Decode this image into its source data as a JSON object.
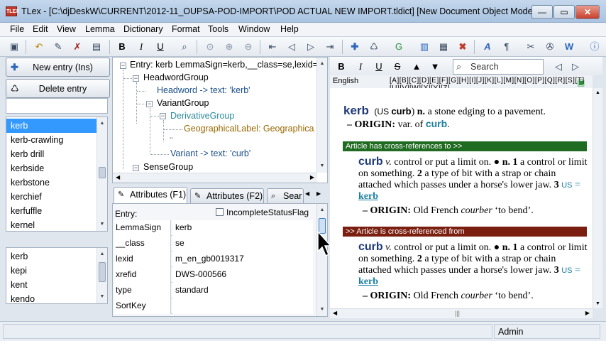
{
  "window": {
    "app_icon": "tlex-icon",
    "app_icon_text": "TLEX",
    "title": "TLex - [C:\\djDeskW\\CURRENT\\2012-11_OUPSA-POD-IMPORT\\POD ACTUAL NEW IMPORT.tldict] [New Document Object Model]",
    "min": "—",
    "max": "▭",
    "close": "✕"
  },
  "menu": [
    "File",
    "Edit",
    "View",
    "Lemma",
    "Dictionary",
    "Format",
    "Tools",
    "Window",
    "Help"
  ],
  "left": {
    "new_entry": "New entry (Ins)",
    "delete_entry": "Delete entry",
    "filter_value": "",
    "entries": [
      "kerb",
      "kerb-crawling",
      "kerb drill",
      "kerbside",
      "kerbstone",
      "kerchief",
      "kerfuffle",
      "kernel"
    ],
    "selected_entry": "kerb",
    "history": [
      "kerb",
      "kepi",
      "kent",
      "kendo"
    ]
  },
  "tree": {
    "root": "Entry: kerb  LemmaSign=kerb,__class=se,lexid=",
    "headword_group": "HeadwordGroup",
    "headword": "Headword -> text: 'kerb'",
    "variant_group": "VariantGroup",
    "derivative_group": "DerivativeGroup",
    "geo_label": "GeographicalLabel:  Geographica",
    "quote": "''",
    "variant": "Variant -> text: 'curb'",
    "sense_group": "SenseGroup"
  },
  "tabs": [
    "Attributes (F1)",
    "Attributes (F2)",
    "Sear"
  ],
  "attributes": {
    "entry_label": "Entry:",
    "incomplete_flag": "IncompleteStatusFlag",
    "rows": [
      {
        "key": "LemmaSign",
        "value": "kerb"
      },
      {
        "key": "__class",
        "value": "se"
      },
      {
        "key": "lexid",
        "value": "m_en_gb0019317"
      },
      {
        "key": "xrefid",
        "value": "DWS-000566"
      },
      {
        "key": "type",
        "value": "standard"
      },
      {
        "key": "SortKey",
        "value": ""
      }
    ]
  },
  "right": {
    "search_placeholder": "Search",
    "language": "English",
    "alphabet": [
      "A",
      "B",
      "C",
      "D",
      "E",
      "F",
      "G",
      "H",
      "I",
      "J",
      "K",
      "L",
      "M",
      "N",
      "O",
      "P",
      "Q",
      "R",
      "S",
      "T",
      "U",
      "V",
      "W",
      "X",
      "Y",
      "Z"
    ],
    "entry1": {
      "headword": "kerb",
      "variant_prefix": "(US ",
      "variant": "curb",
      "variant_suffix": ")",
      "pos": "n.",
      "definition": "a stone edging to a pavement.",
      "origin_label": "– ORIGIN:",
      "origin_text": "var. of",
      "origin_link": "curb"
    },
    "banner1": "Article has cross-references to >>",
    "banner2": ">> Article is cross-referenced from",
    "curb": {
      "headword": "curb",
      "pos": "v.",
      "sense_intro": "control or put a limit on.",
      "bullet": "●",
      "n_pos": "n.",
      "n_num": "1",
      "n_def": "a control or limit on something.",
      "num2": "2",
      "def2": "a type of bit with a strap or chain attached which passes under a horse's lower jaw.",
      "num3": "3",
      "us_label": "US",
      "eq": "=",
      "xref": "kerb",
      "origin_label": "– ORIGIN:",
      "origin_text": "Old French",
      "origin_word": "courber",
      "origin_gloss": "‘to bend’."
    }
  },
  "status": {
    "user": "Admin"
  },
  "colors": {
    "banner_green": "#1f6b21",
    "banner_red": "#7a1e10",
    "headword_blue": "#1f3a78",
    "selection": "#3399ff"
  }
}
